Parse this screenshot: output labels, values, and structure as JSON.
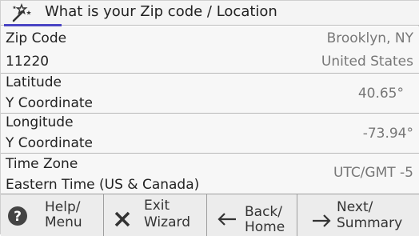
{
  "header": {
    "title": "What is your Zip code / Location",
    "icon": "magic-wand-icon",
    "accent_color": "#4a44c4"
  },
  "fields": {
    "zip": {
      "label": "Zip Code",
      "value": "11220",
      "city": "Brooklyn, NY",
      "country": "United States"
    },
    "latitude": {
      "label": "Latitude",
      "sublabel": "Y Coordinate",
      "value": "40.65°"
    },
    "longitude": {
      "label": "Longitude",
      "sublabel": "Y Coordinate",
      "value": "-73.94°"
    },
    "timezone": {
      "label": "Time Zone",
      "sublabel": "Eastern Time (US & Canada)",
      "value": "UTC/GMT -5"
    }
  },
  "buttons": {
    "help": {
      "line1": "Help/",
      "line2": "Menu",
      "icon": "help-icon"
    },
    "exit": {
      "line1": "Exit",
      "line2": "Wizard",
      "icon": "close-icon"
    },
    "back": {
      "line1": "Back/",
      "line2": "Home",
      "icon": "arrow-left-icon"
    },
    "next": {
      "line1": "Next/",
      "line2": "Summary",
      "icon": "arrow-right-icon"
    }
  }
}
